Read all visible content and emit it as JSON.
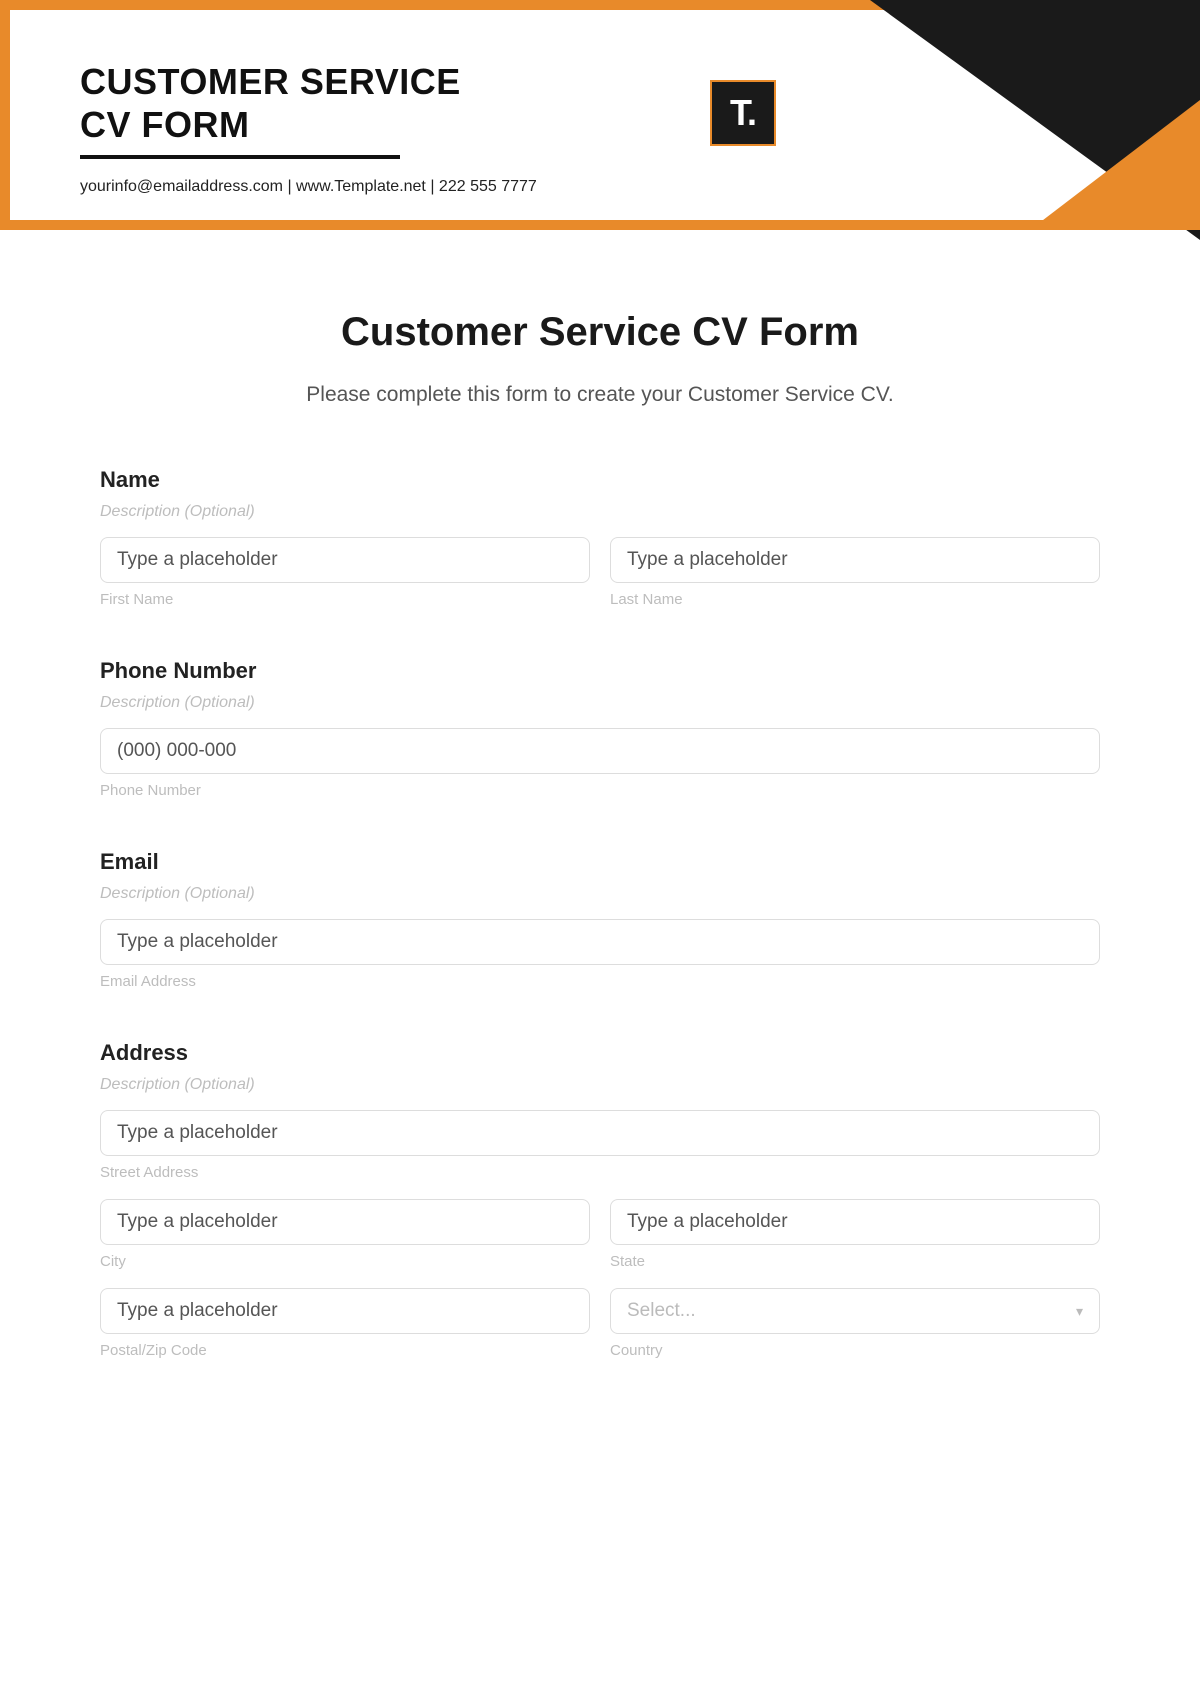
{
  "header": {
    "title_line1": "CUSTOMER SERVICE",
    "title_line2": "CV FORM",
    "contact": "yourinfo@emailaddress.com  |  www.Template.net  |  222 555 7777",
    "logo_text": "T."
  },
  "form": {
    "title": "Customer Service CV Form",
    "subtitle": "Please complete this form to create your Customer Service CV.",
    "desc_placeholder": "Description (Optional)",
    "generic_placeholder": "Type a placeholder",
    "name": {
      "label": "Name",
      "first_sub": "First Name",
      "last_sub": "Last Name"
    },
    "phone": {
      "label": "Phone Number",
      "placeholder": "(000) 000-000",
      "sub": "Phone Number"
    },
    "email": {
      "label": "Email",
      "sub": "Email Address"
    },
    "address": {
      "label": "Address",
      "street_sub": "Street Address",
      "city_sub": "City",
      "state_sub": "State",
      "postal_sub": "Postal/Zip Code",
      "country_sub": "Country",
      "country_placeholder": "Select..."
    }
  }
}
